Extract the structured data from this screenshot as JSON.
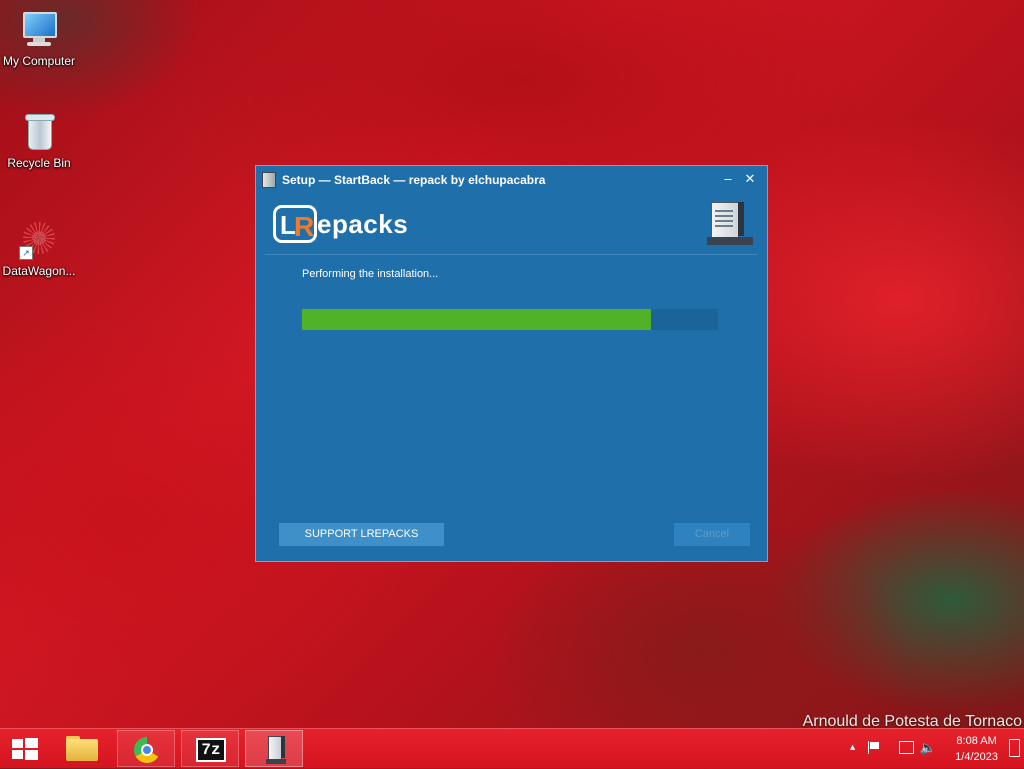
{
  "desktop": {
    "icons": [
      {
        "label": "My Computer"
      },
      {
        "label": "Recycle Bin"
      },
      {
        "label": "DataWagon..."
      }
    ],
    "watermark": "Arnould de Potesta de Tornaco"
  },
  "dialog": {
    "title": "Setup — StartBack — repack by elchupacabra",
    "minimize_glyph": "–",
    "close_glyph": "✕",
    "logo": {
      "l": "L",
      "r": "R",
      "text": "epacks",
      "accent": "#f07a28"
    },
    "status_text": "Performing the installation...",
    "progress": {
      "fraction": 0.84,
      "fill_color": "#51b228"
    },
    "support_button": "SUPPORT LREPACKS",
    "cancel_button": "Cancel",
    "background_color": "#1f6fab"
  },
  "taskbar": {
    "items": [
      {
        "icon": "file-explorer-icon"
      },
      {
        "icon": "chrome-icon"
      },
      {
        "icon": "7zip-icon",
        "label": "7z"
      },
      {
        "icon": "setup-app-icon",
        "active": true
      }
    ],
    "tray": {
      "arrow": "▲",
      "volume_glyph": "🔈",
      "time": "8:08 AM",
      "date": "1/4/2023"
    },
    "color": "#d4141f"
  }
}
